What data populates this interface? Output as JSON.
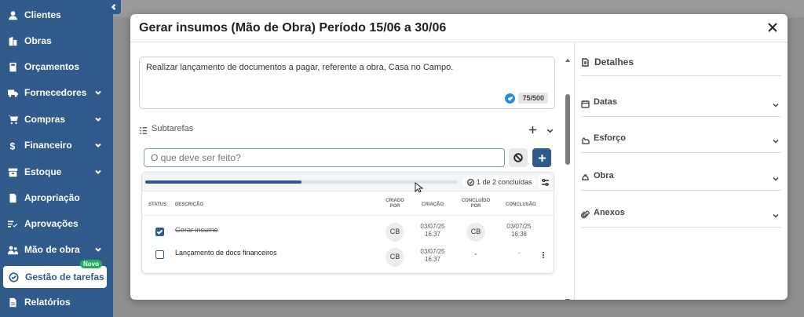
{
  "sidebar": {
    "items": [
      {
        "label": "Clientes",
        "icon": "user-icon",
        "has_chevron": false
      },
      {
        "label": "Obras",
        "icon": "building-icon",
        "has_chevron": false
      },
      {
        "label": "Orçamentos",
        "icon": "calculator-icon",
        "has_chevron": false
      },
      {
        "label": "Fornecedores",
        "icon": "truck-icon",
        "has_chevron": true
      },
      {
        "label": "Compras",
        "icon": "cart-icon",
        "has_chevron": true
      },
      {
        "label": "Financeiro",
        "icon": "dollar-icon",
        "has_chevron": true
      },
      {
        "label": "Estoque",
        "icon": "box-icon",
        "has_chevron": true
      },
      {
        "label": "Apropriação",
        "icon": "document-icon",
        "has_chevron": false
      },
      {
        "label": "Aprovações",
        "icon": "approval-icon",
        "has_chevron": false
      },
      {
        "label": "Mão de obra",
        "icon": "workers-icon",
        "has_chevron": true
      },
      {
        "label": "Gestão de tarefas",
        "icon": "check-circle-icon",
        "has_chevron": false,
        "badge": "Novo",
        "active": true
      },
      {
        "label": "Relatórios",
        "icon": "report-icon",
        "has_chevron": false
      }
    ]
  },
  "modal": {
    "title": "Gerar insumos (Mão de Obra) Período 15/06 a 30/06",
    "description": "Realizar lançamento de documentos a pagar, referente a obra, Casa no Campo.",
    "char_counter": "75/500",
    "subtasks": {
      "label": "Subtarefas",
      "input_placeholder": "O que deve ser feito?",
      "progress_text": "1 de 2 concluídas",
      "progress_fraction": 0.5,
      "columns": {
        "status": "STATUS",
        "description": "DESCRIÇÃO",
        "created_by": "CRIADO POR",
        "created": "CRIAÇÃO",
        "completed_by": "CONCLUÍDO POR",
        "completion": "CONCLUSÃO"
      },
      "rows": [
        {
          "done": true,
          "description": "Gerar insumo",
          "created_by": "CB",
          "created_date": "03/07/25",
          "created_time": "16:37",
          "completed_by": "CB",
          "completed_date": "03/07/25",
          "completed_time": "16:38"
        },
        {
          "done": false,
          "description": "Lançamento de docs financeiros",
          "created_by": "CB",
          "created_date": "03/07/25",
          "created_time": "16:37",
          "completed_by": "-",
          "completed_date": "-"
        }
      ]
    },
    "details": {
      "title": "Detalhes",
      "sections": [
        {
          "label": "Datas",
          "icon": "calendar-icon"
        },
        {
          "label": "Esforço",
          "icon": "effort-icon"
        },
        {
          "label": "Obra",
          "icon": "helmet-icon"
        },
        {
          "label": "Anexos",
          "icon": "paperclip-icon"
        }
      ]
    }
  },
  "colors": {
    "sidebar": "#2f5a8a",
    "accent": "#2f5a8a",
    "badge": "#1fae5b"
  }
}
